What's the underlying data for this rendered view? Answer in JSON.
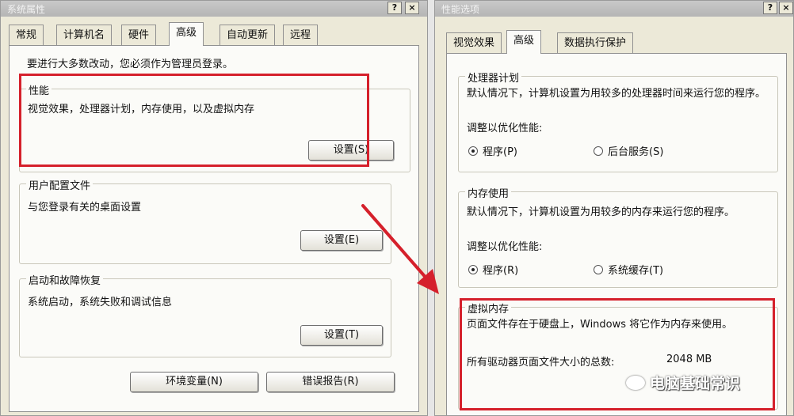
{
  "left_window": {
    "title": "系统属性",
    "help_btn": "?",
    "close_btn": "×",
    "tabs": [
      "常规",
      "计算机名",
      "硬件",
      "高级",
      "自动更新",
      "远程"
    ],
    "notice": "要进行大多数改动，您必须作为管理员登录。",
    "performance": {
      "legend": "性能",
      "desc": "视觉效果，处理器计划，内存使用，以及虚拟内存",
      "button": "设置(S)"
    },
    "user_profiles": {
      "legend": "用户配置文件",
      "desc": "与您登录有关的桌面设置",
      "button": "设置(E)"
    },
    "startup_recovery": {
      "legend": "启动和故障恢复",
      "desc": "系统启动，系统失败和调试信息",
      "button": "设置(T)"
    },
    "env_button": "环境变量(N)",
    "error_button": "错误报告(R)"
  },
  "right_window": {
    "title": "性能选项",
    "help_btn": "?",
    "close_btn": "×",
    "tabs": [
      "视觉效果",
      "高级",
      "数据执行保护"
    ],
    "processor": {
      "legend": "处理器计划",
      "desc": "默认情况下，计算机设置为用较多的处理器时间来运行您的程序。",
      "adjust": "调整以优化性能:",
      "opt_programs": "程序(P)",
      "opt_background": "后台服务(S)"
    },
    "memory": {
      "legend": "内存使用",
      "desc": "默认情况下，计算机设置为用较多的内存来运行您的程序。",
      "adjust": "调整以优化性能:",
      "opt_programs": "程序(R)",
      "opt_cache": "系统缓存(T)"
    },
    "virtual_memory": {
      "legend": "虚拟内存",
      "desc": "页面文件存在于硬盘上，Windows 将它作为内存来使用。",
      "total_label": "所有驱动器页面文件大小的总数:",
      "total_value": "2048 MB"
    }
  },
  "watermark": "电脑基础常识",
  "colors": {
    "highlight": "#d5202b",
    "dialog_bg": "#ece9d8",
    "panel_bg": "#fbfbf8"
  }
}
